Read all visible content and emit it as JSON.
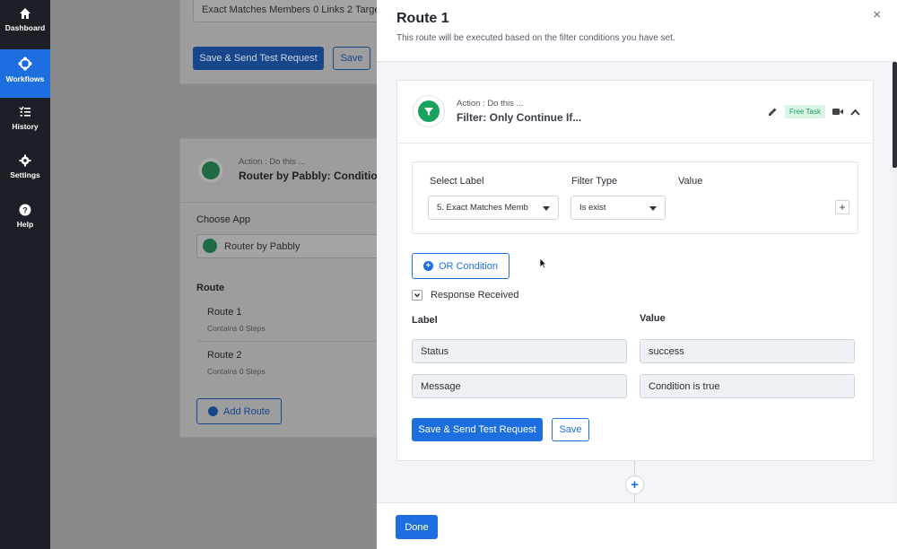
{
  "nav": {
    "items": [
      {
        "label": "Dashboard",
        "icon": "home-icon"
      },
      {
        "label": "Workflows",
        "icon": "workflows-icon",
        "active": true
      },
      {
        "label": "History",
        "icon": "history-icon"
      },
      {
        "label": "Settings",
        "icon": "gear-icon"
      },
      {
        "label": "Help",
        "icon": "help-icon"
      }
    ]
  },
  "background": {
    "top_card": {
      "input_value": "Exact Matches Members 0  Links 2 Targe",
      "primary_btn": "Save & Send Test Request",
      "secondary_btn": "Save"
    },
    "router_card": {
      "action_label": "Action : Do this ...",
      "action_name": "Router by Pabbly: Conditio",
      "choose_app_label": "Choose App",
      "app_value": "Router by Pabbly",
      "route_heading": "Route",
      "routes": [
        {
          "name": "Route 1",
          "steps": "Contains 0 Steps"
        },
        {
          "name": "Route 2",
          "steps": "Contains 0 Steps"
        }
      ],
      "add_route_btn": "Add Route"
    }
  },
  "modal": {
    "title": "Route 1",
    "subtitle": "This route will be executed based on the filter conditions you have set.",
    "close": "×",
    "card": {
      "action_label": "Action : Do this ...",
      "action_prefix": "Filter:",
      "action_name": " Only Continue If...",
      "badge": "Free Task",
      "filter": {
        "select_label_heading": "Select Label",
        "filter_type_heading": "Filter Type",
        "value_heading": "Value",
        "label_value": "5. Exact Matches Memb",
        "filter_type_value": "Is exist",
        "add": "+"
      },
      "or_condition": "OR Condition",
      "response_received": "Response Received",
      "label_col": "Label",
      "value_col": "Value",
      "rows": [
        {
          "label": "Status",
          "value": "success"
        },
        {
          "label": "Message",
          "value": "Condition is true"
        }
      ],
      "save_send_btn": "Save & Send Test Request",
      "save_btn": "Save"
    },
    "add_step": "+",
    "done_btn": "Done"
  },
  "colors": {
    "accent": "#1d6fe0",
    "nav_bg": "#1c1f26",
    "success": "#1aa260"
  }
}
